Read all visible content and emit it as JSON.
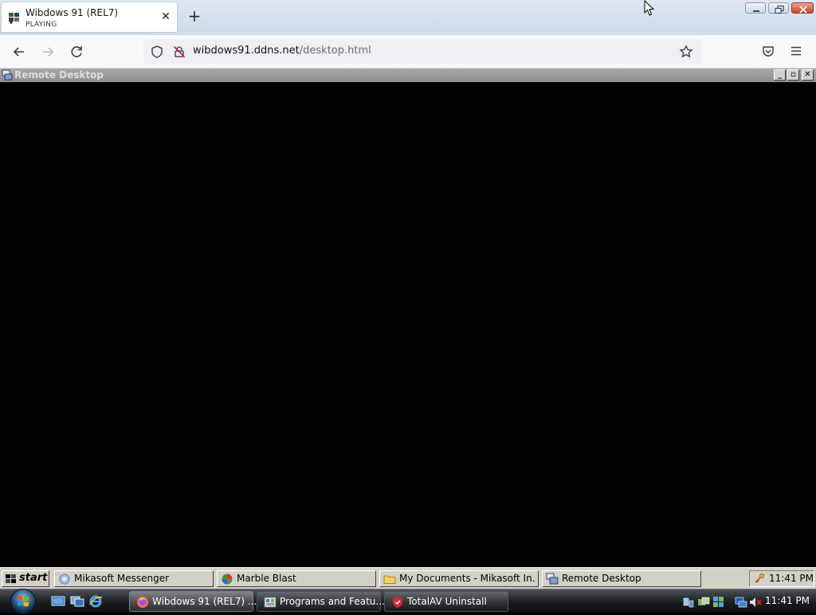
{
  "browser": {
    "tab": {
      "title": "Wibdows 91 (REL7)",
      "status": "PLAYING",
      "close_glyph": "✕"
    },
    "new_tab_glyph": "+",
    "url": {
      "host": "wibdows91.ddns.net",
      "path": "/desktop.html"
    }
  },
  "remote_window": {
    "title": "Remote Desktop",
    "min_glyph": "_",
    "restore_glyph": "▫",
    "close_glyph": "✕"
  },
  "classic_taskbar": {
    "start_label": "start",
    "tasks": [
      {
        "label": "Mikasoft Messenger",
        "icon": "messenger-icon"
      },
      {
        "label": "Marble Blast",
        "icon": "marble-icon"
      },
      {
        "label": "My Documents - Mikasoft In...",
        "icon": "folder-icon"
      },
      {
        "label": "Remote Desktop",
        "icon": "remote-desktop-icon"
      }
    ],
    "clock": "11:41 PM"
  },
  "vista_taskbar": {
    "tasks": [
      {
        "label": "Wibdows 91 (REL7) ...",
        "icon": "firefox-icon",
        "active": true
      },
      {
        "label": "Programs and Featu...",
        "icon": "control-panel-icon",
        "active": false
      },
      {
        "label": "TotalAV Uninstall",
        "icon": "totalav-icon",
        "active": false
      }
    ],
    "clock": "11:41 PM"
  },
  "colors": {
    "remote_titlebar": "#9b9b9b",
    "classic_face": "#d4d0c8",
    "vista_taskbar": "#1a1d20",
    "close_red": "#c8432b"
  }
}
